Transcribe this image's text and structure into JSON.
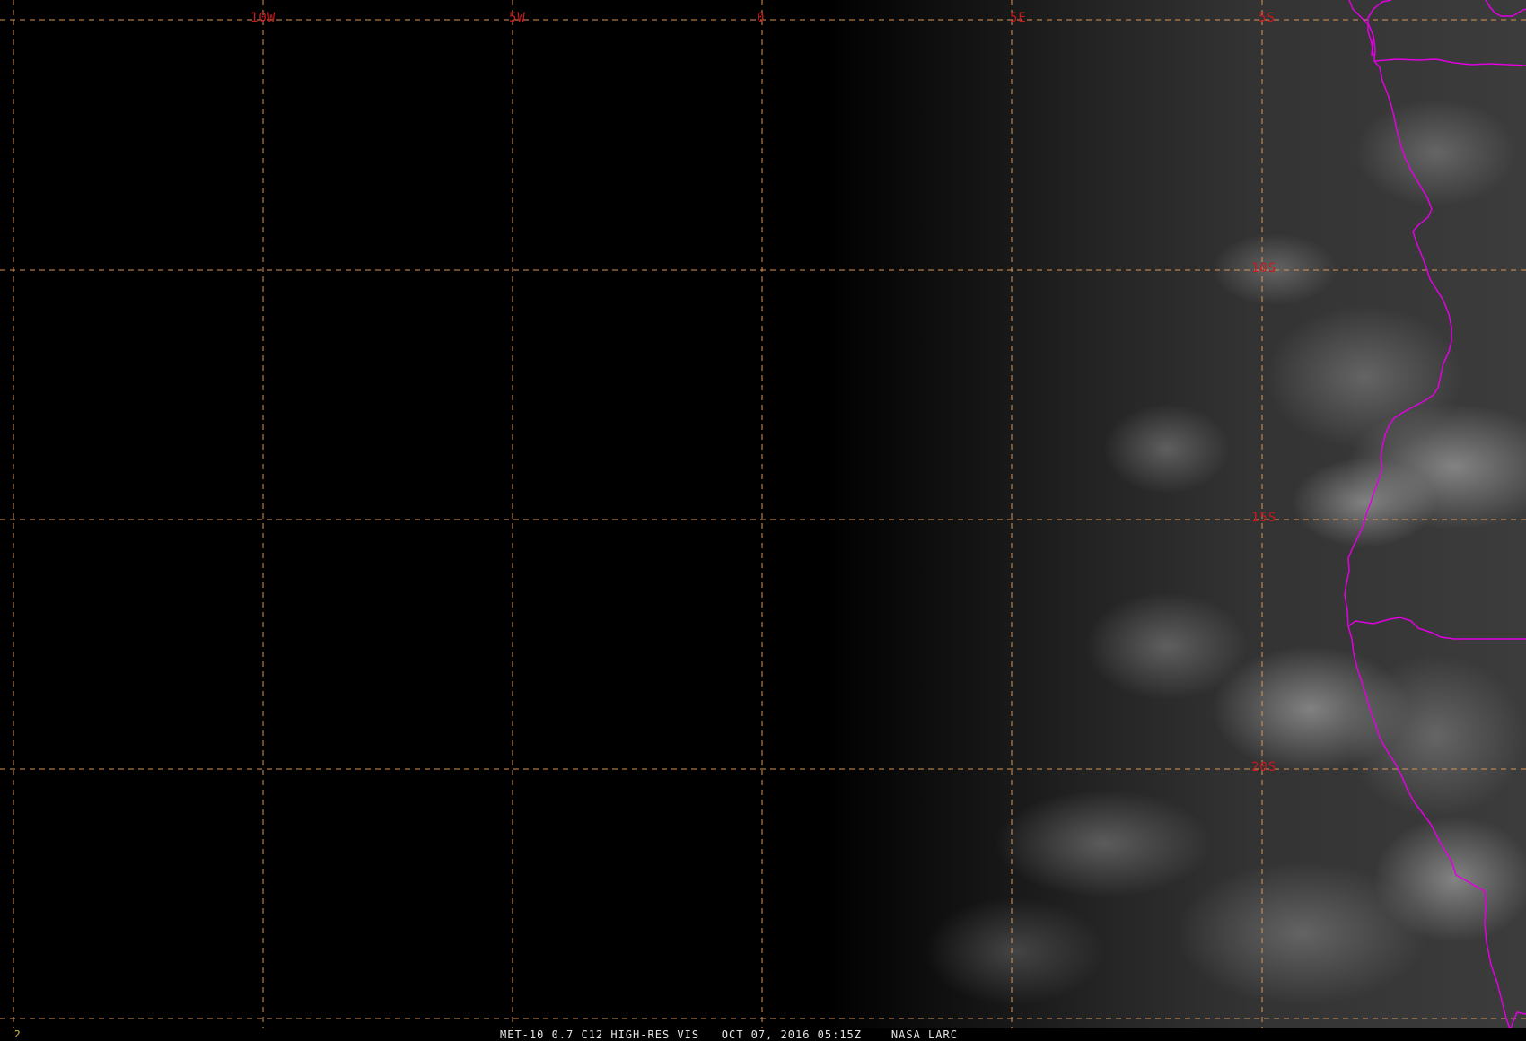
{
  "map": {
    "projection": "satellite",
    "longitude_labels": [
      "10W",
      "5W",
      "0",
      "5E",
      "5S"
    ],
    "latitude_labels": [
      "10S",
      "15S",
      "20S"
    ],
    "colors": {
      "graticule": "#d9965a",
      "grid_labels": "#c8191e",
      "boundaries": "#e000e0",
      "caption": "#e6e6e6",
      "frame_number": "#d8c840"
    }
  },
  "footer": {
    "frame_number": "2",
    "caption": "MET-10 0.7 C12 HIGH-RES VIS   OCT 07, 2016 05:15Z    NASA LARC"
  }
}
